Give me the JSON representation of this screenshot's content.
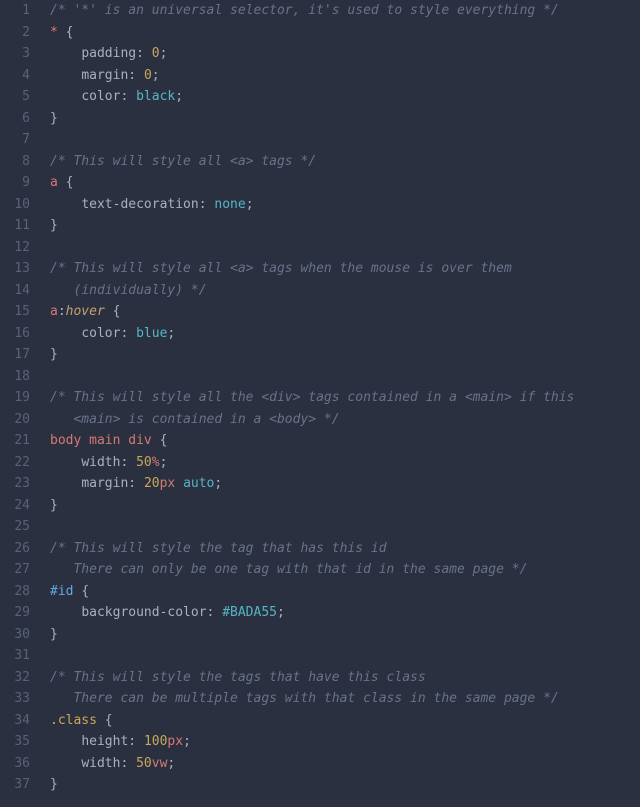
{
  "lines": [
    {
      "n": "1",
      "html": "<span class='cm'>/* '*' is an universal selector, it's used to style everything */</span>"
    },
    {
      "n": "2",
      "html": "<span class='sel'>*</span> <span class='br'>{</span>"
    },
    {
      "n": "3",
      "html": "    <span class='prop'>padding</span><span class='pu'>:</span> <span class='num'>0</span><span class='pu'>;</span>"
    },
    {
      "n": "4",
      "html": "    <span class='prop'>margin</span><span class='pu'>:</span> <span class='num'>0</span><span class='pu'>;</span>"
    },
    {
      "n": "5",
      "html": "    <span class='prop'>color</span><span class='pu'>:</span> <span class='kw'>black</span><span class='pu'>;</span>"
    },
    {
      "n": "6",
      "html": "<span class='br'>}</span>"
    },
    {
      "n": "7",
      "html": ""
    },
    {
      "n": "8",
      "html": "<span class='cm'>/* This will style all &lt;a&gt; tags */</span>"
    },
    {
      "n": "9",
      "html": "<span class='sel'>a</span> <span class='br'>{</span>"
    },
    {
      "n": "10",
      "html": "    <span class='prop'>text-decoration</span><span class='pu'>:</span> <span class='kw'>none</span><span class='pu'>;</span>"
    },
    {
      "n": "11",
      "html": "<span class='br'>}</span>"
    },
    {
      "n": "12",
      "html": ""
    },
    {
      "n": "13",
      "html": "<span class='cm'>/* This will style all &lt;a&gt; tags when the mouse is over them</span>"
    },
    {
      "n": "14",
      "html": "<span class='cm'>   (individually) */</span>"
    },
    {
      "n": "15",
      "html": "<span class='sel'>a</span><span class='pu'>:</span><span class='pc'>hover</span> <span class='br'>{</span>"
    },
    {
      "n": "16",
      "html": "    <span class='prop'>color</span><span class='pu'>:</span> <span class='kw'>blue</span><span class='pu'>;</span>"
    },
    {
      "n": "17",
      "html": "<span class='br'>}</span>"
    },
    {
      "n": "18",
      "html": ""
    },
    {
      "n": "19",
      "html": "<span class='cm'>/* This will style all the &lt;div&gt; tags contained in a &lt;main&gt; if this</span>"
    },
    {
      "n": "20",
      "html": "<span class='cm'>   &lt;main&gt; is contained in a &lt;body&gt; */</span>"
    },
    {
      "n": "21",
      "html": "<span class='sel'>body</span> <span class='sel'>main</span> <span class='sel'>div</span> <span class='br'>{</span>"
    },
    {
      "n": "22",
      "html": "    <span class='prop'>width</span><span class='pu'>:</span> <span class='num'>50</span><span class='un'>%</span><span class='pu'>;</span>"
    },
    {
      "n": "23",
      "html": "    <span class='prop'>margin</span><span class='pu'>:</span> <span class='num'>20</span><span class='un'>px</span> <span class='kw'>auto</span><span class='pu'>;</span>"
    },
    {
      "n": "24",
      "html": "<span class='br'>}</span>"
    },
    {
      "n": "25",
      "html": ""
    },
    {
      "n": "26",
      "html": "<span class='cm'>/* This will style the tag that has this id</span>"
    },
    {
      "n": "27",
      "html": "<span class='cm'>   There can only be one tag with that id in the same page */</span>"
    },
    {
      "n": "28",
      "html": "<span class='id'>#id</span> <span class='br'>{</span>"
    },
    {
      "n": "29",
      "html": "    <span class='prop'>background-color</span><span class='pu'>:</span> <span class='hex'>#BADA55</span><span class='pu'>;</span>"
    },
    {
      "n": "30",
      "html": "<span class='br'>}</span>"
    },
    {
      "n": "31",
      "html": ""
    },
    {
      "n": "32",
      "html": "<span class='cm'>/* This will style the tags that have this class</span>"
    },
    {
      "n": "33",
      "html": "<span class='cm'>   There can be multiple tags with that class in the same page */</span>"
    },
    {
      "n": "34",
      "html": "<span class='cl'>.class</span> <span class='br'>{</span>"
    },
    {
      "n": "35",
      "html": "    <span class='prop'>height</span><span class='pu'>:</span> <span class='num'>100</span><span class='un'>px</span><span class='pu'>;</span>"
    },
    {
      "n": "36",
      "html": "    <span class='prop'>width</span><span class='pu'>:</span> <span class='num'>50</span><span class='un'>vw</span><span class='pu'>;</span>"
    },
    {
      "n": "37",
      "html": "<span class='br'>}</span>"
    }
  ]
}
